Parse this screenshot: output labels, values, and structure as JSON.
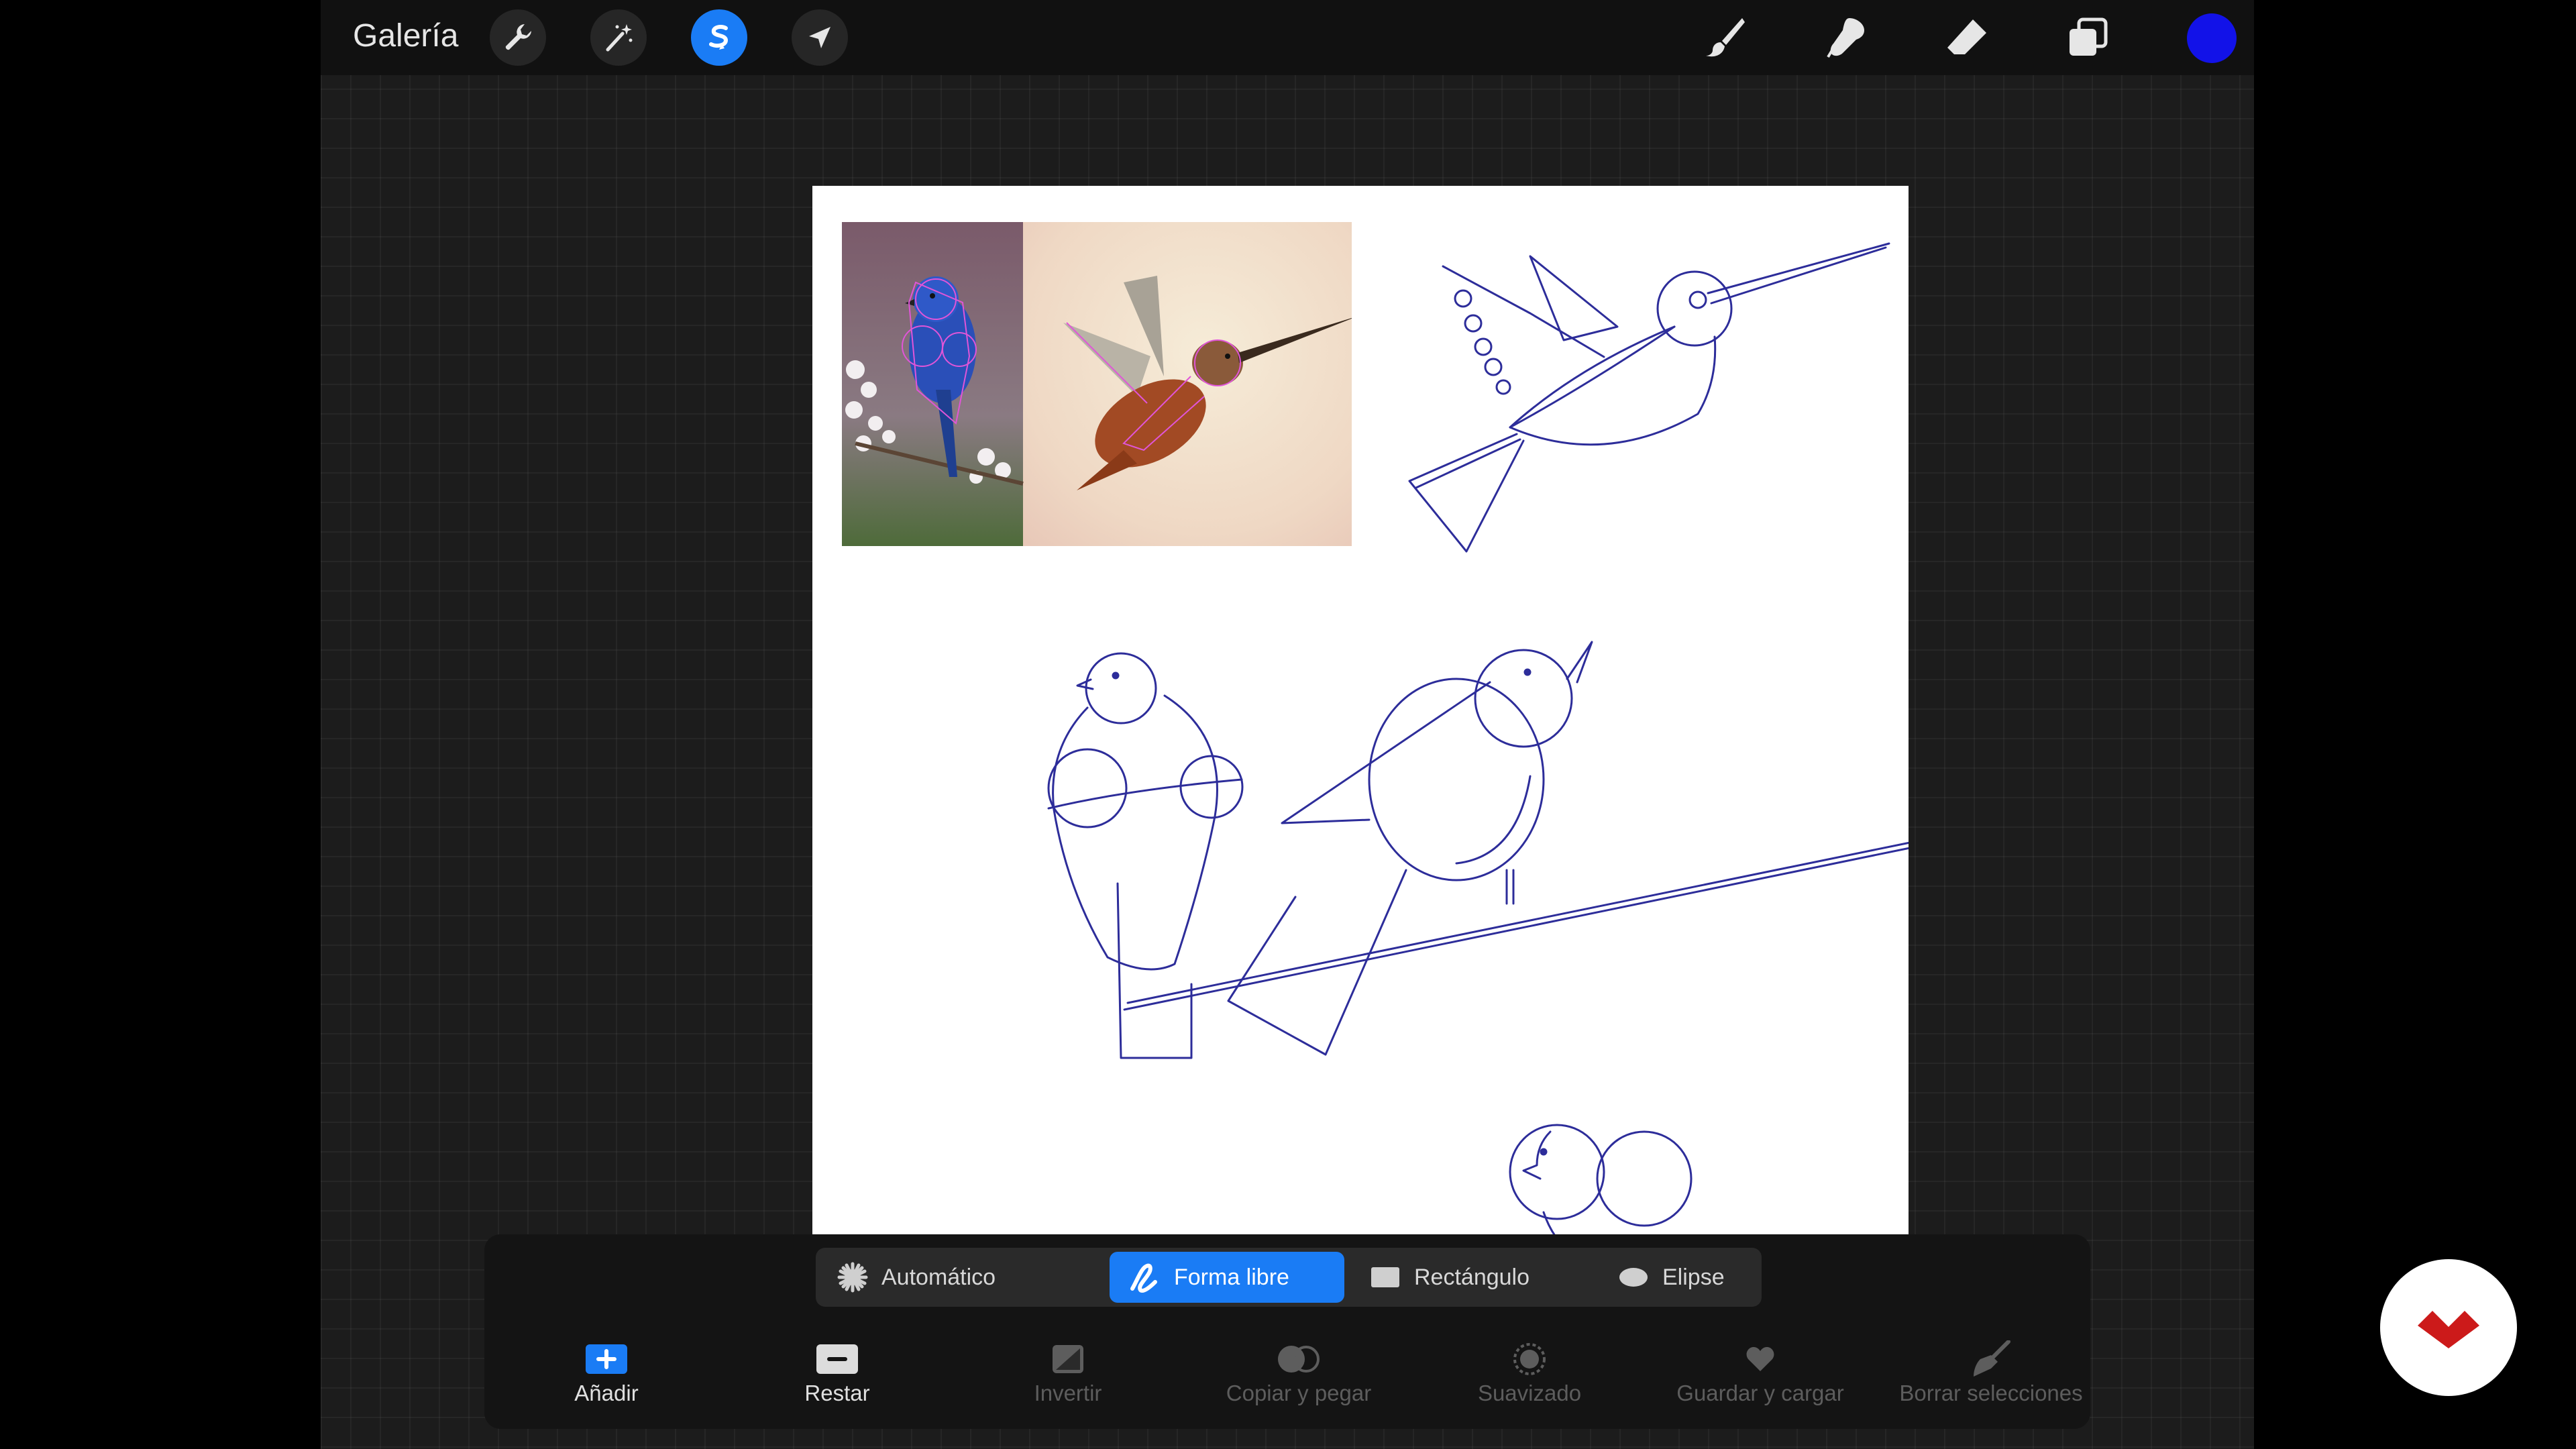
{
  "topbar": {
    "gallery_label": "Galería",
    "tools_left": [
      "wrench-icon",
      "magic-wand-icon",
      "selection-s-icon",
      "move-arrow-icon"
    ],
    "tools_right": [
      "brush-icon",
      "smudge-icon",
      "eraser-icon",
      "layers-icon"
    ],
    "active_tool": "selection-s-icon",
    "active_color": "#1212e8"
  },
  "selection_modes": {
    "items": [
      {
        "label": "Automático",
        "icon": "starburst-icon"
      },
      {
        "label": "Forma libre",
        "icon": "freehand-icon"
      },
      {
        "label": "Rectángulo",
        "icon": "rectangle-icon"
      },
      {
        "label": "Elipse",
        "icon": "ellipse-icon"
      }
    ],
    "active": "Forma libre"
  },
  "actions": [
    {
      "label": "Añadir",
      "icon": "add-icon",
      "enabled": true
    },
    {
      "label": "Restar",
      "icon": "subtract-icon",
      "enabled": true
    },
    {
      "label": "Invertir",
      "icon": "invert-icon",
      "enabled": false
    },
    {
      "label": "Copiar y pegar",
      "icon": "copy-paste-icon",
      "enabled": false
    },
    {
      "label": "Suavizado",
      "icon": "feather-icon",
      "enabled": false
    },
    {
      "label": "Guardar y cargar",
      "icon": "heart-icon",
      "enabled": false
    },
    {
      "label": "Borrar selecciones",
      "icon": "broom-icon",
      "enabled": false
    }
  ],
  "colors": {
    "accent": "#1a7cf5",
    "sketch_ink": "#2d2d9a",
    "guide_pink": "#e055d8"
  },
  "watermark_icon": "brand-logo-icon"
}
